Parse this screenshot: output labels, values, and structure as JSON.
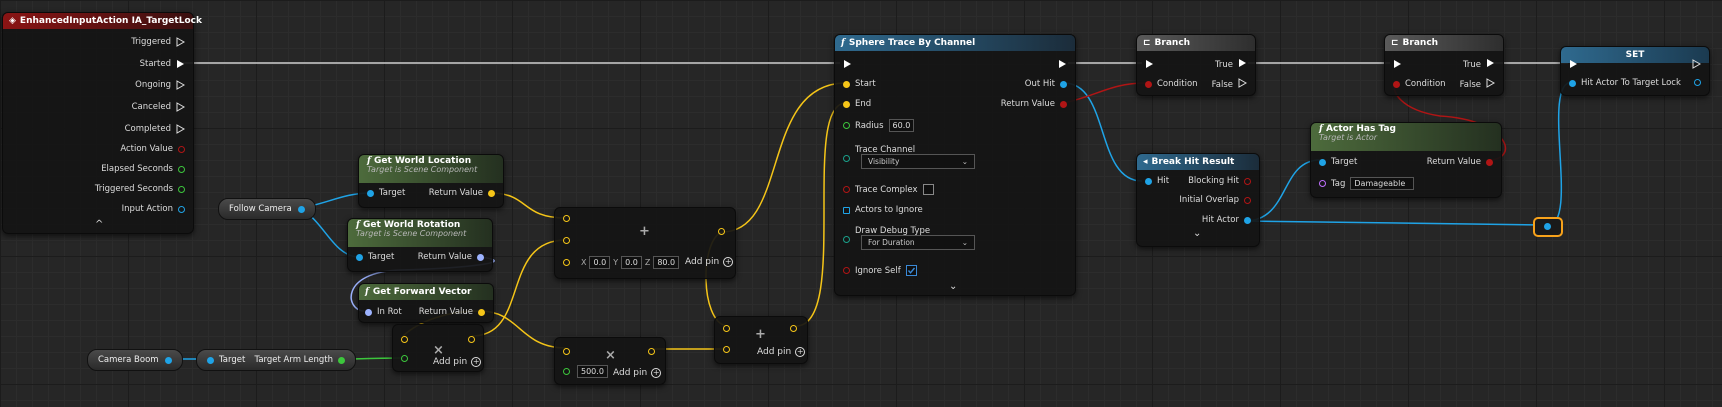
{
  "event_node": {
    "title": "EnhancedInputAction IA_TargetLock",
    "pins": [
      "Triggered",
      "Started",
      "Ongoing",
      "Canceled",
      "Completed",
      "Action Value",
      "Elapsed Seconds",
      "Triggered Seconds",
      "Input Action"
    ],
    "expand": "^"
  },
  "follow_camera": {
    "label": "Follow Camera"
  },
  "camera_boom": {
    "label": "Camera Boom"
  },
  "get_world_location": {
    "title": "Get World Location",
    "subtitle": "Target is Scene Component",
    "in": "Target",
    "out": "Return Value"
  },
  "get_world_rotation": {
    "title": "Get World Rotation",
    "subtitle": "Target is Scene Component",
    "in": "Target",
    "out": "Return Value"
  },
  "get_forward_vector": {
    "title": "Get Forward Vector",
    "in": "In Rot",
    "out": "Return Value"
  },
  "arm_length": {
    "in": "Target",
    "out": "Target Arm Length"
  },
  "add_node_1": {
    "op": "+",
    "x_label": "X",
    "x": "0.0",
    "y_label": "Y",
    "y": "0.0",
    "z_label": "Z",
    "z": "80.0",
    "add_pin": "Add pin"
  },
  "mul_node_1": {
    "op": "×",
    "add_pin": "Add pin"
  },
  "mul_node_2": {
    "op": "×",
    "value": "500.0",
    "add_pin": "Add pin"
  },
  "add_node_2": {
    "op": "+",
    "add_pin": "Add pin"
  },
  "sphere_trace": {
    "title": "Sphere Trace By Channel",
    "start": "Start",
    "end": "End",
    "radius_label": "Radius",
    "radius": "60.0",
    "trace_channel_label": "Trace Channel",
    "trace_channel": "Visibility",
    "trace_complex": "Trace Complex",
    "actors_to_ignore": "Actors to Ignore",
    "draw_debug_label": "Draw Debug Type",
    "draw_debug": "For Duration",
    "ignore_self": "Ignore Self",
    "out_hit": "Out Hit",
    "return_value": "Return Value"
  },
  "branch_1": {
    "title": "Branch",
    "condition": "Condition",
    "true": "True",
    "false": "False"
  },
  "branch_2": {
    "title": "Branch",
    "condition": "Condition",
    "true": "True",
    "false": "False"
  },
  "break_hit": {
    "title": "Break Hit Result",
    "hit": "Hit",
    "blocking": "Blocking Hit",
    "overlap": "Initial Overlap",
    "actor": "Hit Actor"
  },
  "actor_has_tag": {
    "title": "Actor Has Tag",
    "subtitle": "Target is Actor",
    "target": "Target",
    "tag": "Tag",
    "tag_value": "Damageable",
    "return_value": "Return Value"
  },
  "set_node": {
    "title": "SET",
    "var": "Hit Actor To Target Lock"
  },
  "colors": {
    "exec": "#ffffff",
    "object": "#1fa3e6",
    "vector": "#f5c518",
    "rotator": "#9db3ff",
    "bool": "#b01515",
    "float": "#3cc63c",
    "name": "#c070ff"
  }
}
